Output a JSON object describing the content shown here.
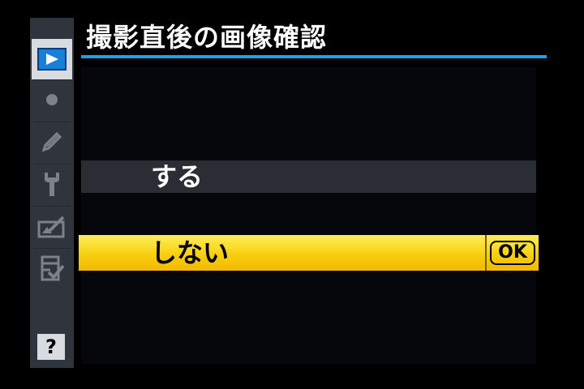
{
  "menu": {
    "title": "撮影直後の画像確認",
    "options": [
      {
        "label": "する",
        "selected": false
      },
      {
        "label": "しない",
        "selected": true,
        "confirm_badge": "OK"
      }
    ]
  },
  "sidebar": {
    "items": [
      {
        "icon": "playback-icon",
        "active": true
      },
      {
        "icon": "shooting-icon",
        "active": false
      },
      {
        "icon": "custom-settings-pencil-icon",
        "active": false
      },
      {
        "icon": "setup-wrench-icon",
        "active": false
      },
      {
        "icon": "retouch-icon",
        "active": false
      },
      {
        "icon": "my-menu-icon",
        "active": false
      }
    ],
    "help_label": "?"
  },
  "colors": {
    "title_rule": "#1aa0e8",
    "highlight_top": "#fdee5a",
    "highlight_bottom": "#f2b800",
    "rail_background": "#30343c",
    "panel_background": "#05070d"
  }
}
